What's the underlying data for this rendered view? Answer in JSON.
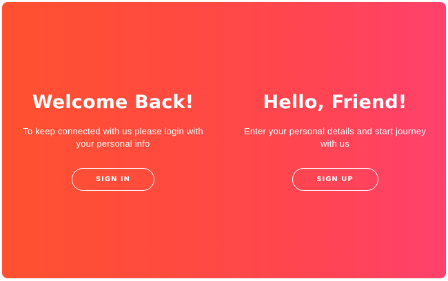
{
  "colors": {
    "gradient_start": "#ff512f",
    "gradient_end": "#ff416c",
    "text": "#ffffff"
  },
  "left_panel": {
    "title": "Welcome Back!",
    "description": "To keep connected with us please login with your personal info",
    "button_label": "SIGN IN"
  },
  "right_panel": {
    "title": "Hello, Friend!",
    "description": "Enter your personal details and start journey with us",
    "button_label": "SIGN UP"
  }
}
